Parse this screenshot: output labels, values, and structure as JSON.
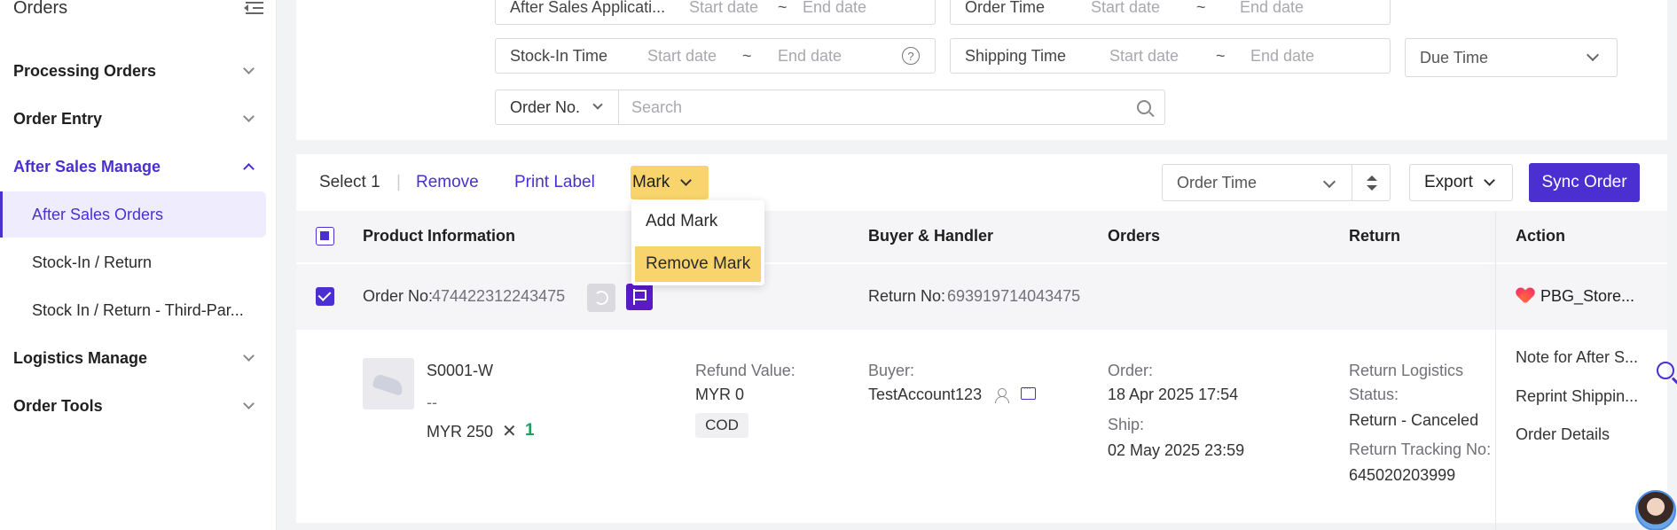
{
  "sidebar": {
    "title": "Orders",
    "groups": [
      {
        "label": "Processing Orders"
      },
      {
        "label": "Order Entry"
      },
      {
        "label": "After Sales Manage"
      },
      {
        "label": "Logistics Manage"
      },
      {
        "label": "Order Tools"
      }
    ],
    "sub_items": [
      {
        "label": "After Sales Orders"
      },
      {
        "label": "Stock-In / Return"
      },
      {
        "label": "Stock In / Return - Third-Par..."
      }
    ]
  },
  "filters": {
    "after_sales_label": "After Sales Applicati...",
    "order_time_label": "Order Time",
    "stock_in_label": "Stock-In Time",
    "shipping_time_label": "Shipping Time",
    "due_time_label": "Due Time",
    "order_no_label": "Order No.",
    "start_ph": "Start date",
    "end_ph": "End date",
    "tilde": "~",
    "help": "?",
    "search_ph": "Search"
  },
  "toolbar": {
    "select_count": "Select 1",
    "remove": "Remove",
    "print_label": "Print Label",
    "mark": "Mark",
    "sort_field": "Order Time",
    "export": "Export",
    "sync": "Sync Order"
  },
  "mark_menu": {
    "add": "Add Mark",
    "remove": "Remove Mark"
  },
  "table": {
    "headers": {
      "product": "Product Information",
      "buyer": "Buyer & Handler",
      "orders": "Orders",
      "return": "Return",
      "action": "Action"
    }
  },
  "order": {
    "order_no_label": "Order No:",
    "order_no": "474422312243475",
    "return_no_label": "Return No:",
    "return_no": "693919714043475",
    "store": "PBG_Store...",
    "sku": "S0001-W",
    "variant": "--",
    "price": "MYR 250",
    "qty_x": "✕",
    "qty": "1",
    "refund_label": "Refund Value:",
    "refund": "MYR 0",
    "payment": "COD",
    "buyer_label": "Buyer:",
    "buyer": "TestAccount123",
    "order_label": "Order:",
    "order_date": "18 Apr 2025 17:54",
    "ship_label": "Ship:",
    "ship_date": "02 May 2025 23:59",
    "return_logistics_label": "Return Logistics",
    "status_label": "Status:",
    "status": "Return - Canceled",
    "tracking_label": "Return Tracking No:",
    "tracking": "645020203999",
    "actions": [
      "Note for After S...",
      "Reprint Shippin...",
      "Order Details"
    ]
  },
  "colors": {
    "accent": "#4b2fd0",
    "mark_highlight": "#f9d46c",
    "qty_green": "#1aa05a"
  }
}
